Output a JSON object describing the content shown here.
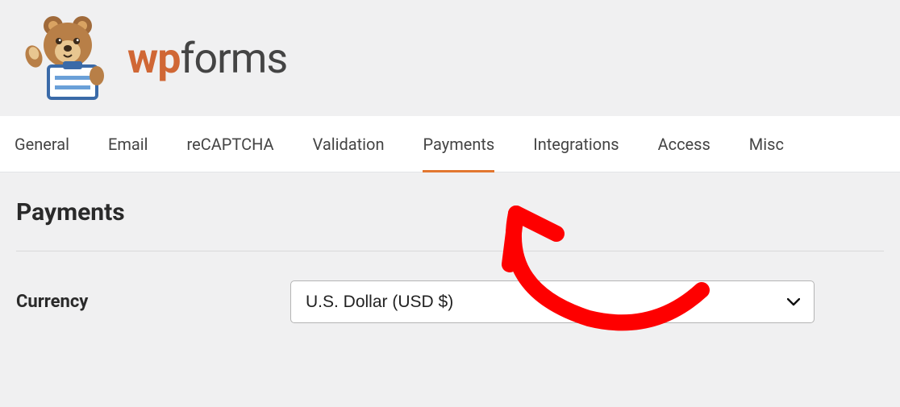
{
  "brand": {
    "name_part1": "wp",
    "name_part2": "forms"
  },
  "tabs": [
    {
      "label": "General",
      "active": false
    },
    {
      "label": "Email",
      "active": false
    },
    {
      "label": "reCAPTCHA",
      "active": false
    },
    {
      "label": "Validation",
      "active": false
    },
    {
      "label": "Payments",
      "active": true
    },
    {
      "label": "Integrations",
      "active": false
    },
    {
      "label": "Access",
      "active": false
    },
    {
      "label": "Misc",
      "active": false
    }
  ],
  "section": {
    "title": "Payments",
    "currency_label": "Currency",
    "currency_value": "U.S. Dollar (USD $)"
  },
  "colors": {
    "accent": "#e27730",
    "annotation": "#fe0000"
  }
}
